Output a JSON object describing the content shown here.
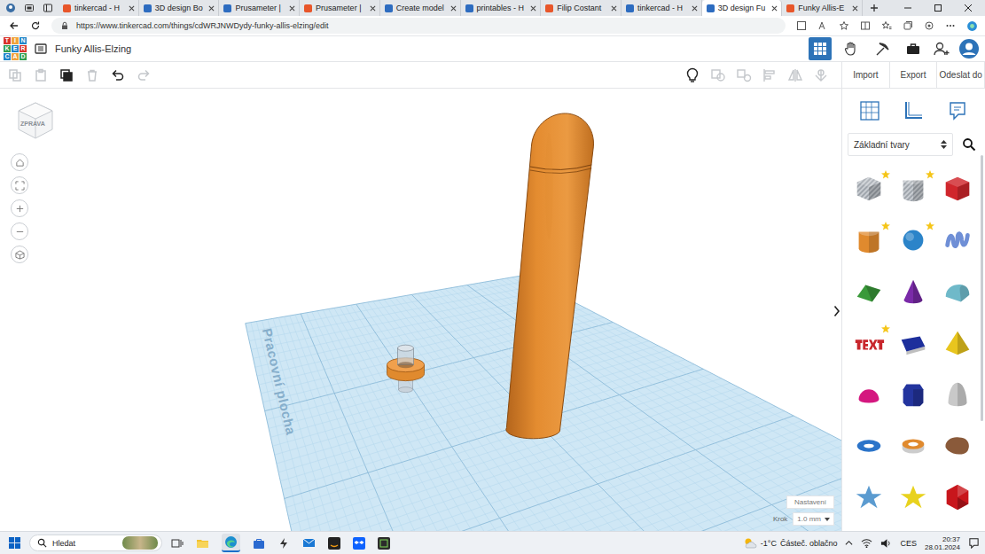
{
  "browser": {
    "tabs": [
      {
        "label": "tinkercad - H",
        "selected": false
      },
      {
        "label": "3D design Bo",
        "selected": false
      },
      {
        "label": "Prusameter |",
        "selected": false
      },
      {
        "label": "Prusameter |",
        "selected": false
      },
      {
        "label": "Create model",
        "selected": false
      },
      {
        "label": "printables - H",
        "selected": false
      },
      {
        "label": "Filip Costant",
        "selected": false
      },
      {
        "label": "tinkercad - H",
        "selected": false
      },
      {
        "label": "3D design Fu",
        "selected": true
      },
      {
        "label": "Funky Allis-E",
        "selected": false
      }
    ],
    "url": "https://www.tinkercad.com/things/cdWRJNWDydy-funky-allis-elzing/edit"
  },
  "app": {
    "logo": [
      {
        "letter": "T",
        "color": "#d9342b"
      },
      {
        "letter": "I",
        "color": "#f0a23b"
      },
      {
        "letter": "N",
        "color": "#1f85c9"
      },
      {
        "letter": "K",
        "color": "#2e9e4f"
      },
      {
        "letter": "E",
        "color": "#1f85c9"
      },
      {
        "letter": "R",
        "color": "#d9342b"
      },
      {
        "letter": "C",
        "color": "#1f85c9"
      },
      {
        "letter": "A",
        "color": "#f0a23b"
      },
      {
        "letter": "D",
        "color": "#2e9e4f"
      }
    ],
    "title": "Funky Allis-Elzing",
    "header_tools": [
      {
        "kind": "grid",
        "selected": true
      },
      {
        "kind": "hand",
        "selected": false
      },
      {
        "kind": "pickaxe",
        "selected": false
      },
      {
        "kind": "briefcase",
        "selected": false
      }
    ]
  },
  "toolbar": {
    "edit_tools": [
      {
        "kind": "copy",
        "disabled": true
      },
      {
        "kind": "paste",
        "disabled": true
      },
      {
        "kind": "duplicate",
        "disabled": false
      },
      {
        "kind": "delete",
        "disabled": true
      },
      {
        "kind": "undo",
        "disabled": false
      },
      {
        "kind": "redo",
        "disabled": true
      }
    ],
    "view_tools": [
      {
        "kind": "lightbulb",
        "disabled": false
      },
      {
        "kind": "group",
        "disabled": true
      },
      {
        "kind": "ungroup",
        "disabled": true
      },
      {
        "kind": "align",
        "disabled": true
      },
      {
        "kind": "mirror",
        "disabled": true
      },
      {
        "kind": "cruise",
        "disabled": true
      }
    ]
  },
  "panel": {
    "actions": [
      "Import",
      "Export",
      "Odeslat do"
    ],
    "category": "Základní tvary",
    "shapes": [
      {
        "kind": "box",
        "color": "#b9bec4",
        "hole": true,
        "starred": true
      },
      {
        "kind": "cylinder",
        "color": "#b9bec4",
        "hole": true,
        "starred": true
      },
      {
        "kind": "box",
        "color": "#d0262c",
        "hole": false,
        "starred": false
      },
      {
        "kind": "cylinder",
        "color": "#e08a2e",
        "hole": false,
        "starred": true
      },
      {
        "kind": "sphere",
        "color": "#2b84c9",
        "hole": false,
        "starred": true
      },
      {
        "kind": "scribble",
        "color": "#6f8fd6",
        "hole": false,
        "starred": false
      },
      {
        "kind": "roof",
        "color": "#3a9a3a",
        "hole": false,
        "starred": false
      },
      {
        "kind": "cone",
        "color": "#7a2aa8",
        "hole": false,
        "starred": false
      },
      {
        "kind": "round-roof",
        "color": "#6fb9c9",
        "hole": false,
        "starred": false
      },
      {
        "kind": "text",
        "color": "#c8262c",
        "hole": false,
        "starred": true
      },
      {
        "kind": "wedge",
        "color": "#1d2f9c",
        "hole": false,
        "starred": false
      },
      {
        "kind": "pyramid",
        "color": "#e8c51e",
        "hole": false,
        "starred": false
      },
      {
        "kind": "half-sphere",
        "color": "#d4177f",
        "hole": false,
        "starred": false
      },
      {
        "kind": "polygon",
        "color": "#23349e",
        "hole": false,
        "starred": false
      },
      {
        "kind": "paraboloid",
        "color": "#c9c9c9",
        "hole": false,
        "starred": false
      },
      {
        "kind": "torus",
        "color": "#2b74c9",
        "hole": false,
        "starred": false
      },
      {
        "kind": "tube",
        "color": "#e08a2e",
        "hole": false,
        "starred": false
      },
      {
        "kind": "blob",
        "color": "#8a5a3a",
        "hole": false,
        "starred": false
      },
      {
        "kind": "star",
        "color": "#5b9bd0",
        "hole": false,
        "starred": false
      },
      {
        "kind": "star",
        "color": "#e8d21e",
        "hole": false,
        "starred": false
      },
      {
        "kind": "icosahedron",
        "color": "#c8161c",
        "hole": false,
        "starred": false
      }
    ]
  },
  "viewport": {
    "view_cube": "ZPRAVA",
    "workplane_label": "Pracovní plocha",
    "settings": "Nastavení",
    "step_label": "Krok",
    "step_value": "1.0 mm",
    "objects": [
      {
        "kind": "peg",
        "color": "#e08a2e"
      },
      {
        "kind": "rounded-cylinder",
        "color": "#e08a2e"
      }
    ]
  },
  "taskbar": {
    "search": "Hledat",
    "temperature": "-1°C",
    "weather": "Částeč. oblačno",
    "language": "CES",
    "time": "20:37",
    "date": "28.01.2024"
  }
}
